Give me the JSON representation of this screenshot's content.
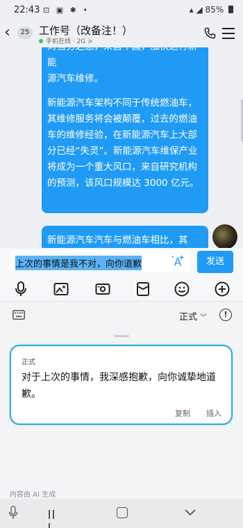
{
  "status_bar": {
    "time": "22:43",
    "left_icons": "⊡ ▣ ✱ •",
    "right_text": "85%"
  },
  "header": {
    "back_badge": "25",
    "title": "工作号（改备注！）",
    "subtitle": "手机在线 · 2G >"
  },
  "chat": {
    "bubble1_paragraphs": [
      "源汽车维修。",
      "新能源汽车架构不同于传统燃油车，其维修服务将会被颠覆，过去的燃油车的维修经验，在新能源汽车上大部分已经“失灵”。新能源汽车维保产业将成为一个重大风口，来自研究机构的预测，该风口规模达 3000 亿元。"
    ],
    "bubble1_partial_top": "对当务之急，来自中国，加快进行新能",
    "bubble2_text": "新能源汽车汽车与燃油车相比，其"
  },
  "input": {
    "value": "上次的事情是我不对，向你道歉",
    "send_label": "发送"
  },
  "panel": {
    "mode_label": "正式",
    "card_label": "正式",
    "result_text": "对于上次的事情，我深感抱歉，向你诚挚地道歉。",
    "copy_label": "复制",
    "insert_label": "插入",
    "ai_note": "内容由 AI 生成"
  },
  "colors": {
    "accent": "#1f9bf6",
    "card_border": "#33a9e8"
  }
}
